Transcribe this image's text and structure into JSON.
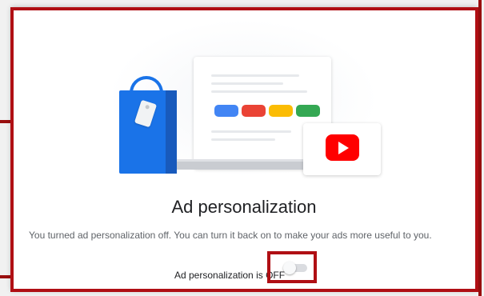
{
  "dialog": {
    "title": "Ad personalization",
    "description": "You turned ad personalization off. You can turn it back on to make your ads more useful to you.",
    "status_label": "Ad personalization is OFF",
    "toggle_state": "off"
  },
  "illustration": {
    "pill_colors": [
      "#4285f4",
      "#ea4335",
      "#fbbc04",
      "#34a853"
    ],
    "icons": [
      "shopping-bag-icon",
      "youtube-icon",
      "laptop-icon",
      "tablet-icon"
    ]
  },
  "colors": {
    "highlight_border": "#b00f14",
    "brand_blue": "#1a73e8",
    "youtube_red": "#ff0000"
  }
}
